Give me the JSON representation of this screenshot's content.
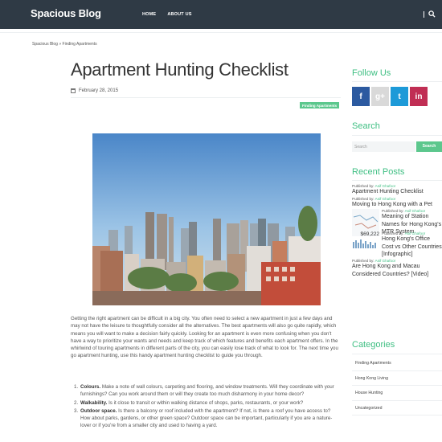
{
  "header": {
    "brand": "Spacious Blog",
    "nav": [
      "HOME",
      "ABOUT US"
    ]
  },
  "breadcrumb": "Spacious Blog » Finding Apartments",
  "article": {
    "title": "Apartment Hunting Checklist",
    "date": "February 28, 2015",
    "category": "Finding Apartments",
    "intro": "Getting the right apartment can be difficult in a big city. You often need to select a new apartment in just a few days and may not have the leisure to thoughtfully consider all the alternatives. The best apartments will also go quite rapidly, which means you will want to make a decision fairly quickly. Looking for an apartment is even more confusing when you don't have a way to prioritize your wants and needs and keep track of which features and benefits each apartment offers. In the whirlwind of touring apartments in different parts of the city, you can easily lose track of what to look for. The next time you go apartment hunting, use this handy apartment hunting checklist to guide you through.",
    "checklist": [
      {
        "term": "Colours.",
        "text": " Make a note of wall colours, carpeting and flooring, and window treatments. Will they coordinate with your furnishings? Can you work around them or will they create too much disharmony in your home decor?"
      },
      {
        "term": "Walkability.",
        "text": " Is it close to transit or within walking distance of shops, parks, restaurants, or your work?"
      },
      {
        "term": "Outdoor space.",
        "text": " Is there a balcony or roof included with the apartment? If not, is there a roof you have access to? How about parks, gardens, or other green space? Outdoor space can be important, particularly if you are a nature-lover or if you're from a smaller city and used to having a yard."
      }
    ]
  },
  "sidebar": {
    "follow_title": "Follow Us",
    "social": [
      {
        "icon": "f",
        "color": "#2c5aa0"
      },
      {
        "icon": "g+",
        "color": "#d0d0d0"
      },
      {
        "icon": "t",
        "color": "#1d9ad8"
      },
      {
        "icon": "in",
        "color": "#c02e54"
      }
    ],
    "search_title": "Search",
    "search_placeholder": "Search",
    "search_button": "Search",
    "recent_title": "Recent Posts",
    "published_by": "Published by:",
    "author": "Asif Ghafoor",
    "recent_posts": [
      "Apartment Hunting Checklist",
      "Moving to Hong Kong with a Pet",
      "Meaning of Station Names for Hong Kong's MTR System",
      "Hong Kong's Office Cost vs Other Countries [Infographic]",
      "Are Hong Kong and Macau Considered Countries? [Video]"
    ],
    "thumb_value": "$69,222",
    "categories_title": "Categories",
    "categories": [
      "Finding Apartments",
      "Hong Kong Living",
      "House Hunting",
      "Uncategorized"
    ]
  }
}
